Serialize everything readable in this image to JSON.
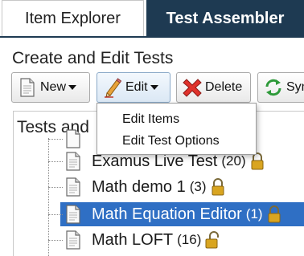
{
  "tabs": [
    {
      "label": "Item Explorer",
      "active": false
    },
    {
      "label": "Test Assembler",
      "active": true
    }
  ],
  "section_title": "Create and Edit Tests",
  "toolbar": {
    "new_label": "New",
    "edit_label": "Edit",
    "delete_label": "Delete",
    "sync_label": "Sync"
  },
  "edit_menu": [
    {
      "label": "Edit Items"
    },
    {
      "label": "Edit Test Options"
    }
  ],
  "panel_title": "Tests and",
  "tests": [
    {
      "name": "Examus Live Test",
      "count": "(20)",
      "lock": "locked",
      "selected": false
    },
    {
      "name": "Math demo 1",
      "count": "(3)",
      "lock": "locked",
      "selected": false
    },
    {
      "name": "Math Equation Editor",
      "count": "(1)",
      "lock": "locked",
      "selected": true
    },
    {
      "name": "Math LOFT",
      "count": "(16)",
      "lock": "unlocked",
      "selected": false
    }
  ],
  "colors": {
    "tab_active_bg": "#1e3a52",
    "selection_bg": "#2f6fc4",
    "lock_gold": "#d9a520"
  },
  "icons": {
    "new": "new-document-icon",
    "edit": "pencil-icon",
    "delete": "red-x-icon",
    "sync": "green-sync-icon",
    "test": "document-icon",
    "lock": "padlock-icon"
  }
}
